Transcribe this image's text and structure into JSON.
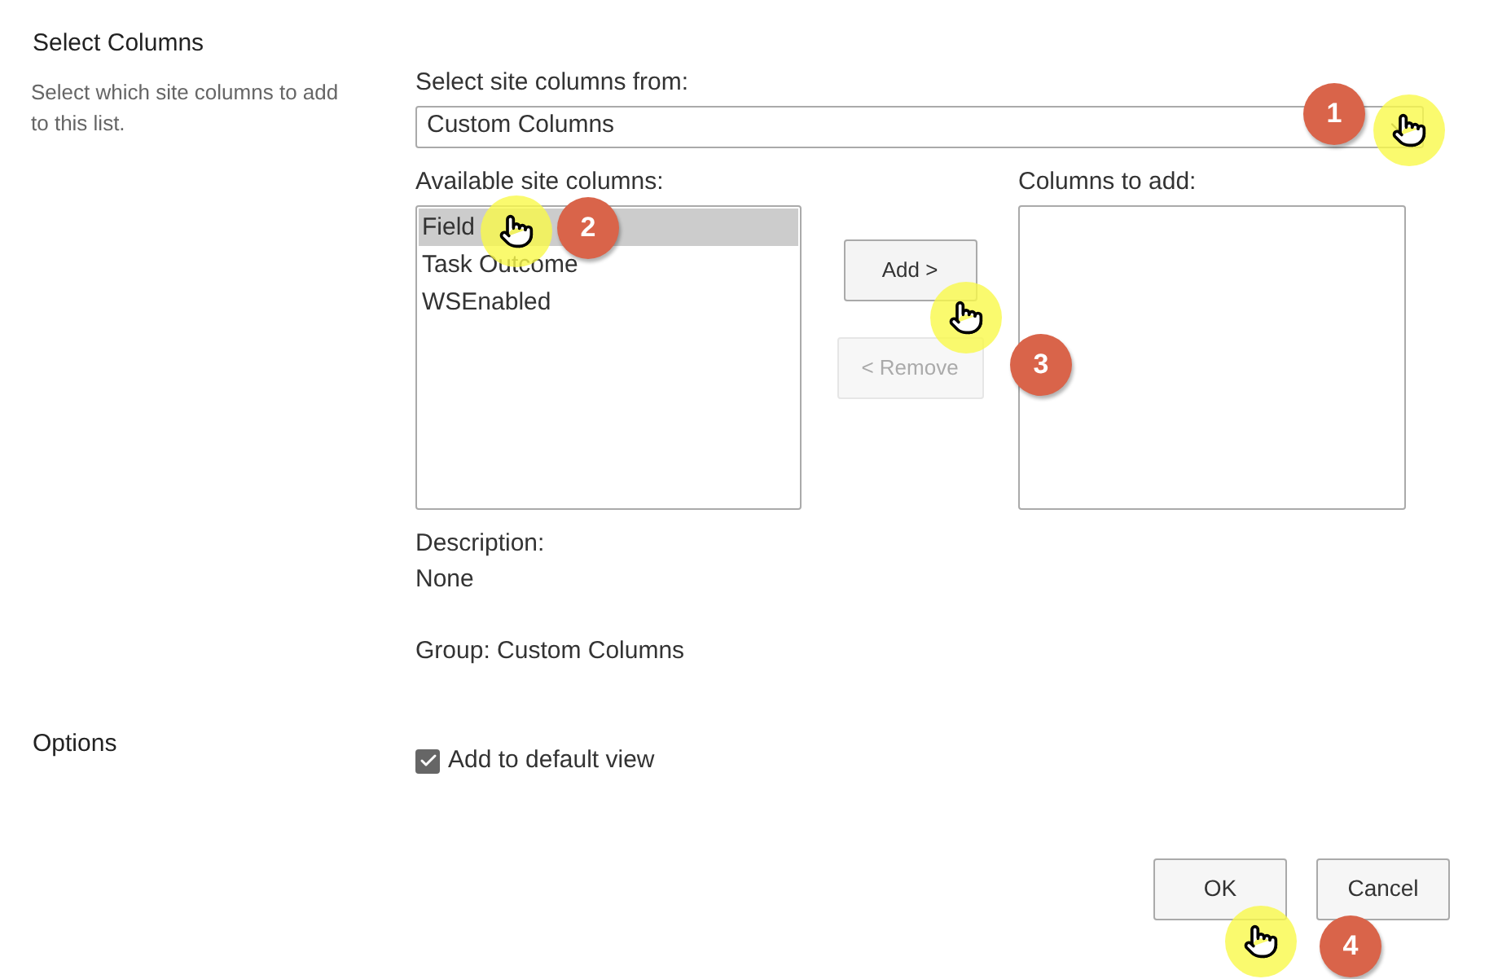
{
  "section": {
    "title": "Select Columns",
    "description": "Select which site columns to add to this list."
  },
  "source": {
    "label": "Select site columns from:",
    "value": "Custom Columns"
  },
  "available": {
    "label": "Available site columns:",
    "items": [
      {
        "label": "Field",
        "selected": true
      },
      {
        "label": "Task Outcome",
        "selected": false
      },
      {
        "label": "WSEnabled",
        "selected": false
      }
    ]
  },
  "move_buttons": [
    {
      "label": "Add >",
      "disabled": false
    },
    {
      "label": "< Remove",
      "disabled": true
    }
  ],
  "to_add": {
    "label": "Columns to add:"
  },
  "details": {
    "description_label": "Description:",
    "description": "None",
    "group": "Group: Custom Columns"
  },
  "options": {
    "title": "Options",
    "checkbox": {
      "label": "Add to default view",
      "checked": true
    }
  },
  "footer_buttons": [
    "OK",
    "Cancel"
  ],
  "steps": [
    "1",
    "2",
    "3",
    "4"
  ]
}
